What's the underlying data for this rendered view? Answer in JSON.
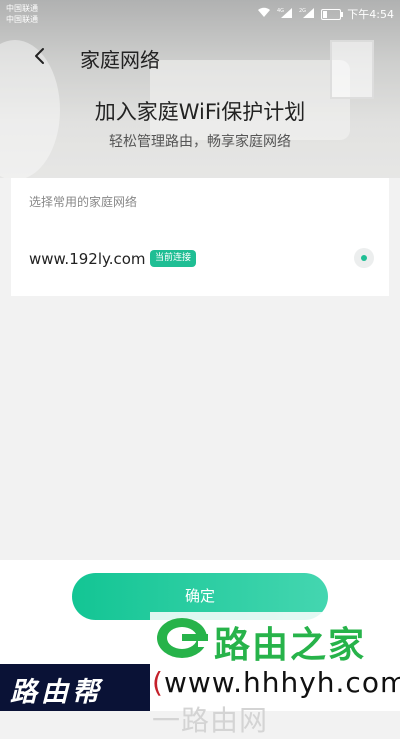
{
  "status_bar": {
    "carrier_1": "中国联通",
    "carrier_2": "中国联通",
    "network_1": "4G",
    "network_2": "2G",
    "time": "下午4:54"
  },
  "header": {
    "title": "家庭网络",
    "headline": "加入家庭WiFi保护计划",
    "subtitle": "轻松管理路由，畅享家庭网络"
  },
  "network_card": {
    "label": "选择常用的家庭网络",
    "networks": [
      {
        "name": "www.192ly.com",
        "badge": "当前连接",
        "selected": true
      }
    ]
  },
  "footer": {
    "confirm_label": "确定"
  },
  "watermark": {
    "logo_text": "路由之家",
    "left_text": "路由帮",
    "url_open": "(",
    "url": "www.hhhyh.com",
    "url_faint": "一路由网"
  },
  "colors": {
    "accent": "#1fbe94",
    "logo_green": "#27b34a",
    "paren_red": "#c4202a"
  }
}
